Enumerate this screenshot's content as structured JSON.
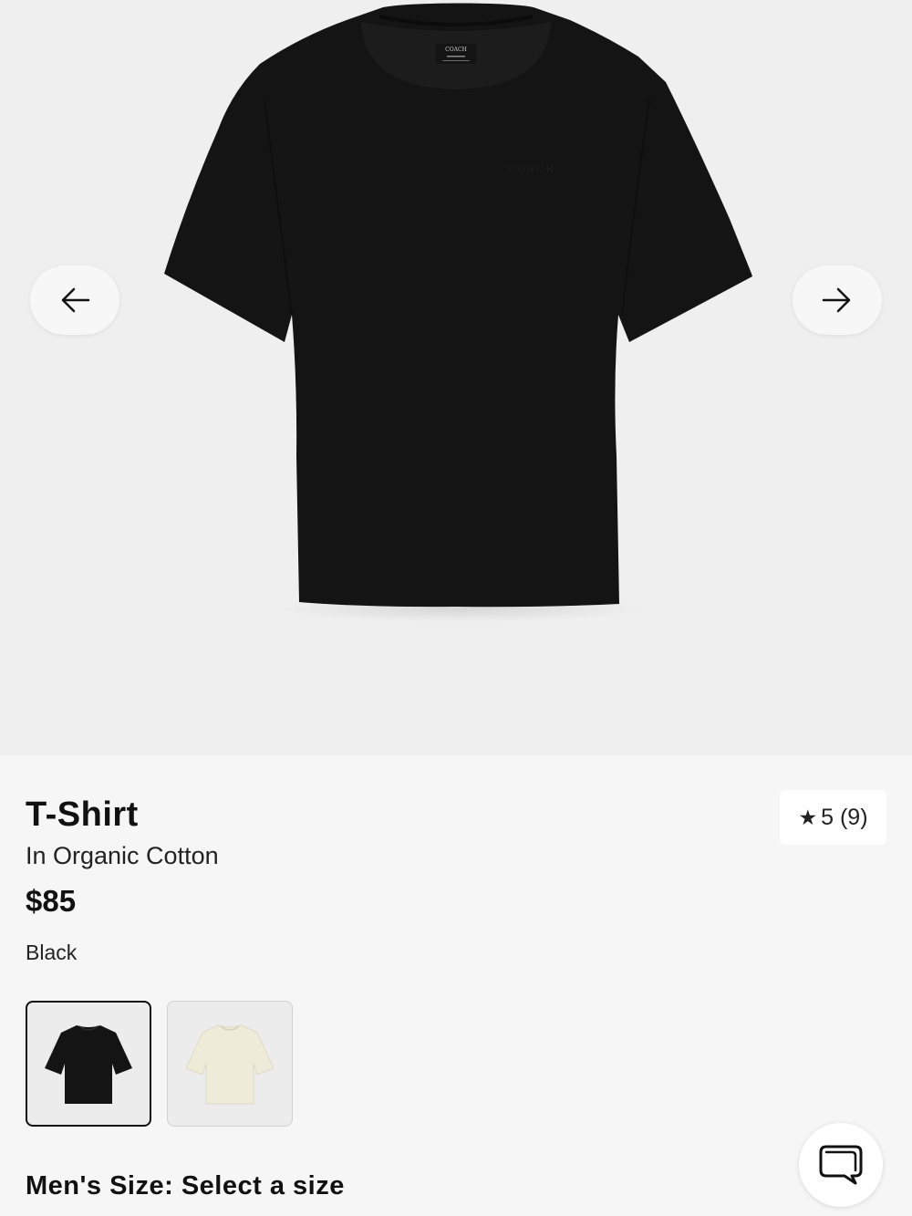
{
  "gallery": {
    "product_image_alt": "T-Shirt black",
    "label_brand": "COACH",
    "prev_icon": "arrow-left-icon",
    "next_icon": "arrow-right-icon"
  },
  "product": {
    "title": "T-Shirt",
    "subtitle": "In Organic Cotton",
    "price": "$85",
    "color_name": "Black",
    "rating": {
      "icon": "star-icon",
      "text": "5 (9)"
    },
    "swatches": [
      {
        "color": "Black",
        "hex": "#111111"
      },
      {
        "color": "Chalk",
        "hex": "#eeebd9"
      }
    ],
    "size_label": "Men's Size: Select a size"
  },
  "chat": {
    "icon": "chat-bubbles-icon"
  },
  "colors": {
    "gallery_bg": "#efefef",
    "page_bg": "#f6f6f6",
    "text": "#111111"
  }
}
